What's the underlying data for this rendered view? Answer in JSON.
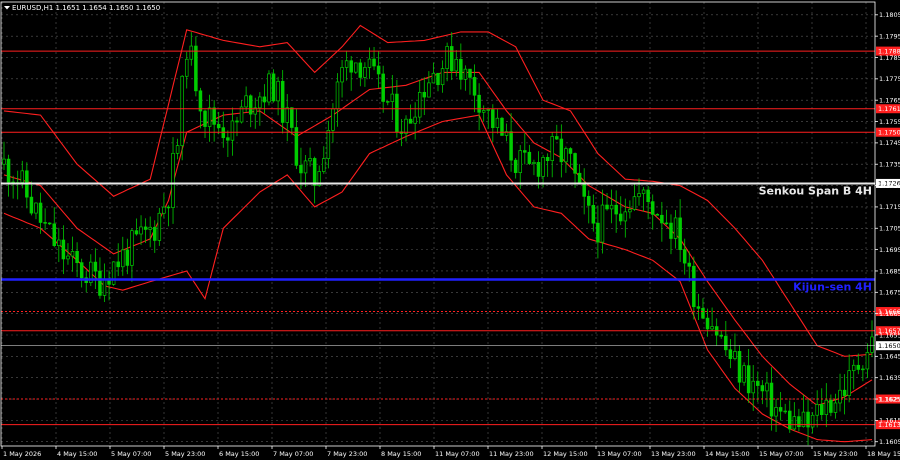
{
  "header": {
    "title": "EURUSD,H1  1.1651 1.1654 1.1650 1.1650"
  },
  "colors": {
    "background": "#000000",
    "grid": "#5a5a5a",
    "frame": "#ffffff",
    "candle": "#00cc00",
    "bands": "#ff1f1f",
    "level_red": "#ff1f1f",
    "kijun": "#2020ff",
    "senkou": "#e8e8e8",
    "price_line": "#c8c8c8",
    "tag_red_bg": "#ff1f1f",
    "tag_white_bg": "#ffffff"
  },
  "chart_data": {
    "type": "candlestick",
    "symbol": "EURUSD",
    "timeframe": "H1",
    "ylim": [
      1.1603,
      1.1811
    ],
    "grid": true,
    "y_ticks": [
      "1.1805",
      "1.1795",
      "1.1785",
      "1.1775",
      "1.1765",
      "1.1755",
      "1.1745",
      "1.1735",
      "1.1725",
      "1.1715",
      "1.1705",
      "1.1695",
      "1.1685",
      "1.1675",
      "1.1665",
      "1.1655",
      "1.1645",
      "1.1635",
      "1.1625",
      "1.1615",
      "1.1605"
    ],
    "x_ticks": [
      "1 May 2026",
      "4 May 15:00",
      "5 May 07:00",
      "5 May 23:00",
      "6 May 15:00",
      "7 May 07:00",
      "7 May 23:00",
      "8 May 15:00",
      "11 May 07:00",
      "11 May 23:00",
      "12 May 15:00",
      "13 May 07:00",
      "13 May 23:00",
      "14 May 15:00",
      "15 May 07:00",
      "15 May 23:00",
      "18 May 15:00"
    ],
    "price_path": [
      [
        0,
        1.1735
      ],
      [
        3,
        1.1729
      ],
      [
        6,
        1.1716
      ],
      [
        9,
        1.1705
      ],
      [
        12,
        1.1695
      ],
      [
        15,
        1.1688
      ],
      [
        18,
        1.1684
      ],
      [
        21,
        1.1681
      ],
      [
        24,
        1.1688
      ],
      [
        27,
        1.1694
      ],
      [
        30,
        1.17
      ],
      [
        33,
        1.1706
      ],
      [
        36,
        1.1722
      ],
      [
        38,
        1.1745
      ],
      [
        40,
        1.1792
      ],
      [
        42,
        1.1775
      ],
      [
        44,
        1.1758
      ],
      [
        47,
        1.1754
      ],
      [
        50,
        1.175
      ],
      [
        53,
        1.1763
      ],
      [
        56,
        1.1768
      ],
      [
        59,
        1.1772
      ],
      [
        62,
        1.1755
      ],
      [
        65,
        1.1735
      ],
      [
        68,
        1.1728
      ],
      [
        70,
        1.1744
      ],
      [
        72,
        1.1762
      ],
      [
        74,
        1.1778
      ],
      [
        76,
        1.1785
      ],
      [
        79,
        1.1782
      ],
      [
        82,
        1.177
      ],
      [
        85,
        1.176
      ],
      [
        88,
        1.1752
      ],
      [
        90,
        1.1765
      ],
      [
        93,
        1.1776
      ],
      [
        96,
        1.1782
      ],
      [
        99,
        1.1786
      ],
      [
        101,
        1.1776
      ],
      [
        103,
        1.1771
      ],
      [
        106,
        1.1758
      ],
      [
        109,
        1.1748
      ],
      [
        112,
        1.1737
      ],
      [
        115,
        1.1732
      ],
      [
        118,
        1.1738
      ],
      [
        121,
        1.1742
      ],
      [
        124,
        1.1735
      ],
      [
        126,
        1.172
      ],
      [
        128,
        1.171
      ],
      [
        130,
        1.1706
      ],
      [
        133,
        1.1712
      ],
      [
        136,
        1.1718
      ],
      [
        139,
        1.172
      ],
      [
        142,
        1.1716
      ],
      [
        145,
        1.171
      ],
      [
        148,
        1.17
      ],
      [
        150,
        1.1682
      ],
      [
        152,
        1.167
      ],
      [
        155,
        1.1662
      ],
      [
        158,
        1.1648
      ],
      [
        161,
        1.1638
      ],
      [
        164,
        1.1632
      ],
      [
        167,
        1.1625
      ],
      [
        170,
        1.1618
      ],
      [
        173,
        1.1614
      ],
      [
        176,
        1.1612
      ],
      [
        179,
        1.1621
      ],
      [
        182,
        1.1626
      ],
      [
        185,
        1.1633
      ],
      [
        188,
        1.1646
      ],
      [
        190,
        1.1652
      ]
    ],
    "bands": {
      "upper": [
        [
          0,
          1.176
        ],
        [
          8,
          1.1758
        ],
        [
          16,
          1.1735
        ],
        [
          24,
          1.172
        ],
        [
          32,
          1.1728
        ],
        [
          40,
          1.1798
        ],
        [
          48,
          1.1793
        ],
        [
          56,
          1.179
        ],
        [
          62,
          1.1792
        ],
        [
          68,
          1.1778
        ],
        [
          74,
          1.179
        ],
        [
          78,
          1.18
        ],
        [
          84,
          1.1792
        ],
        [
          92,
          1.1793
        ],
        [
          100,
          1.1797
        ],
        [
          106,
          1.1797
        ],
        [
          112,
          1.179
        ],
        [
          118,
          1.1765
        ],
        [
          124,
          1.176
        ],
        [
          130,
          1.174
        ],
        [
          136,
          1.1728
        ],
        [
          142,
          1.1727
        ],
        [
          148,
          1.1725
        ],
        [
          154,
          1.1718
        ],
        [
          160,
          1.1705
        ],
        [
          166,
          1.169
        ],
        [
          172,
          1.167
        ],
        [
          178,
          1.165
        ],
        [
          184,
          1.1645
        ],
        [
          190,
          1.1646
        ]
      ],
      "lower": [
        [
          0,
          1.1712
        ],
        [
          8,
          1.1705
        ],
        [
          16,
          1.169
        ],
        [
          22,
          1.1678
        ],
        [
          26,
          1.1676
        ],
        [
          32,
          1.168
        ],
        [
          40,
          1.1685
        ],
        [
          44,
          1.1672
        ],
        [
          48,
          1.1705
        ],
        [
          56,
          1.1722
        ],
        [
          62,
          1.173
        ],
        [
          68,
          1.1715
        ],
        [
          74,
          1.1722
        ],
        [
          80,
          1.174
        ],
        [
          88,
          1.1748
        ],
        [
          96,
          1.1755
        ],
        [
          104,
          1.1758
        ],
        [
          110,
          1.173
        ],
        [
          116,
          1.1715
        ],
        [
          122,
          1.1712
        ],
        [
          128,
          1.17
        ],
        [
          136,
          1.1695
        ],
        [
          142,
          1.169
        ],
        [
          148,
          1.168
        ],
        [
          154,
          1.1648
        ],
        [
          160,
          1.163
        ],
        [
          166,
          1.1618
        ],
        [
          172,
          1.1611
        ],
        [
          178,
          1.1606
        ],
        [
          184,
          1.1605
        ],
        [
          190,
          1.1606
        ]
      ],
      "mid": [
        [
          0,
          1.173
        ],
        [
          8,
          1.1725
        ],
        [
          16,
          1.1705
        ],
        [
          24,
          1.1693
        ],
        [
          32,
          1.17
        ],
        [
          36,
          1.1718
        ],
        [
          40,
          1.175
        ],
        [
          48,
          1.1758
        ],
        [
          56,
          1.176
        ],
        [
          64,
          1.1748
        ],
        [
          72,
          1.1758
        ],
        [
          80,
          1.177
        ],
        [
          88,
          1.1772
        ],
        [
          96,
          1.1778
        ],
        [
          104,
          1.1778
        ],
        [
          110,
          1.176
        ],
        [
          116,
          1.1745
        ],
        [
          122,
          1.1738
        ],
        [
          128,
          1.1725
        ],
        [
          136,
          1.1715
        ],
        [
          142,
          1.1712
        ],
        [
          148,
          1.17
        ],
        [
          154,
          1.168
        ],
        [
          160,
          1.1662
        ],
        [
          166,
          1.1645
        ],
        [
          172,
          1.1632
        ],
        [
          178,
          1.1622
        ],
        [
          184,
          1.1626
        ],
        [
          190,
          1.1634
        ]
      ]
    },
    "levels": [
      {
        "value": 1.1788,
        "label": "",
        "tag": "1.1788",
        "style": "solid",
        "color": "red"
      },
      {
        "value": 1.1761,
        "label": "",
        "tag": "1.1761",
        "style": "solid",
        "color": "red"
      },
      {
        "value": 1.175,
        "label": "",
        "tag": "1.1750",
        "style": "solid",
        "color": "red"
      },
      {
        "value": 1.1726,
        "label": "Senkou Span B 4H",
        "tag": "1.1726",
        "style": "solid",
        "color": "white"
      },
      {
        "value": 1.1681,
        "label": "Kijun-sen 4H",
        "tag": "",
        "style": "thick",
        "color": "blue"
      },
      {
        "value": 1.1666,
        "label": "",
        "tag": "1.1666",
        "style": "dotted",
        "color": "red"
      },
      {
        "value": 1.1657,
        "label": "",
        "tag": "1.1657",
        "style": "solid",
        "color": "red"
      },
      {
        "value": 1.165,
        "label": "",
        "tag": "1.1650",
        "style": "price",
        "color": "white"
      },
      {
        "value": 1.1625,
        "label": "",
        "tag": "1.1625",
        "style": "dotted",
        "color": "red"
      },
      {
        "value": 1.1613,
        "label": "",
        "tag": "1.1613",
        "style": "solid",
        "color": "red"
      }
    ]
  }
}
